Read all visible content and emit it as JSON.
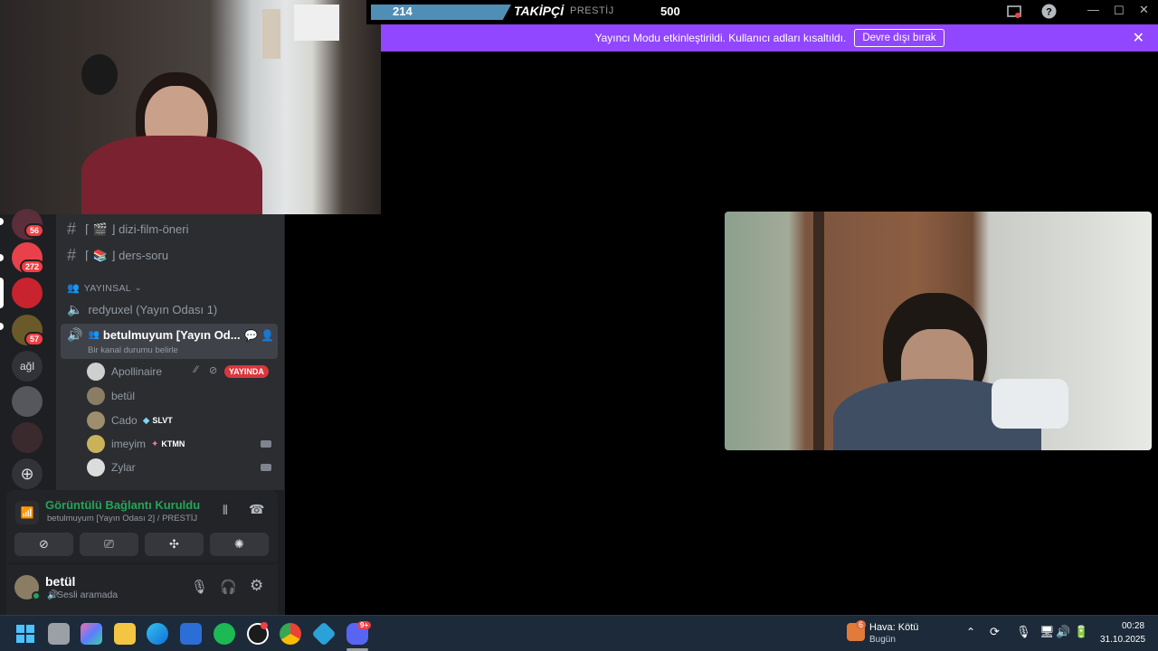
{
  "overlay": {
    "followers_count": "214",
    "followers_label": "TAKİPÇİ",
    "prestige_label": "PRESTİJ",
    "goal_value": "500"
  },
  "banner": {
    "message": "Yayıncı Modu etkinleştirildi. Kullanıcı adları kısaltıldı.",
    "disable_label": "Devre dışı bırak",
    "close_icon": "close-icon"
  },
  "servers": [
    {
      "badge": "56",
      "color": "#5a2e3a"
    },
    {
      "badge": "272",
      "color": "#e8414b"
    },
    {
      "badge": "",
      "color": "#c8232f"
    },
    {
      "badge": "57",
      "color": "#6a5a2a"
    },
    {
      "label": "ağl",
      "color": "#313338"
    },
    {
      "badge": "",
      "color": "#55575c"
    },
    {
      "badge": "",
      "color": "#3a2a2e"
    }
  ],
  "channels": {
    "text1": "⌈ 🎬 ⌋ dizi-film-öneri",
    "text2": "⌈ 📚 ⌋ ders-soru",
    "category": "YAYINSAL",
    "voice1": "redyuxel (Yayın Odası 1)",
    "active_voice": "betulmuyum [Yayın Od...",
    "active_status": "Bir kanal durumu belirle",
    "users": [
      {
        "name": "Apollinaire",
        "tag": "",
        "color": "#cfcfcf"
      },
      {
        "name": "betül",
        "tag": "",
        "color": "#8a7d64"
      },
      {
        "name": "Cado",
        "tag": "SLVT",
        "color": "#9e8e6e"
      },
      {
        "name": "imeyim",
        "tag": "KTMN",
        "color": "#c9b25a"
      },
      {
        "name": "Zylar",
        "tag": "",
        "color": "#dcdcdc"
      }
    ],
    "live_label": "YAYINDA"
  },
  "voice": {
    "status": "Görüntülü Bağlantı Kuruldu",
    "channel": "betulmuyum [Yayın Odası 2] / PRESTİJ"
  },
  "user": {
    "name": "betül",
    "status": "Sesli aramada"
  },
  "taskbar": {
    "weather_title": "Hava: Kötü",
    "weather_sub": "Bugün",
    "weather_badge": "6",
    "time": "00:28",
    "date": "31.10.2025",
    "discord_badge": "9+"
  }
}
